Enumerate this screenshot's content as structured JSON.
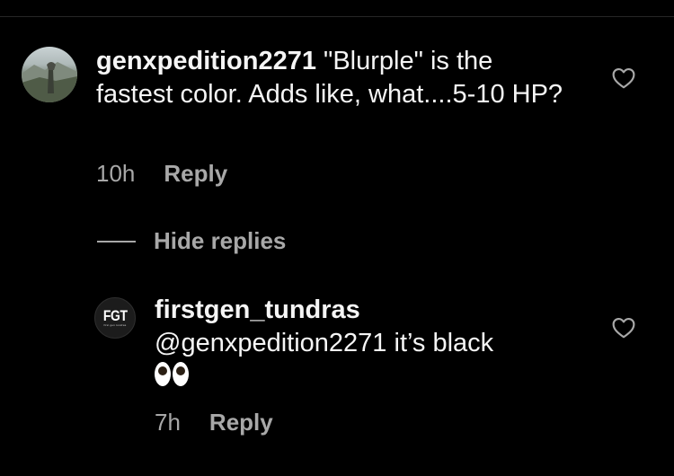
{
  "comments": [
    {
      "username": "genxpedition2271",
      "text": "\"Blurple\" is the fastest color. Adds like, what....5-10 HP?",
      "time": "10h",
      "reply_label": "Reply",
      "avatar": "profile-photo-landscape"
    },
    {
      "username": "firstgen_tundras",
      "mention": "@genxpedition2271",
      "text": " it’s black",
      "emoji": "👀",
      "time": "7h",
      "reply_label": "Reply",
      "avatar_text": "FGT",
      "avatar_subtext": "first gen tundras"
    }
  ],
  "thread": {
    "hide_replies_label": "Hide replies"
  },
  "icons": {
    "like": "heart-outline-icon"
  },
  "colors": {
    "background": "#000000",
    "text": "#f5f5f5",
    "muted": "#a8a8a8"
  }
}
